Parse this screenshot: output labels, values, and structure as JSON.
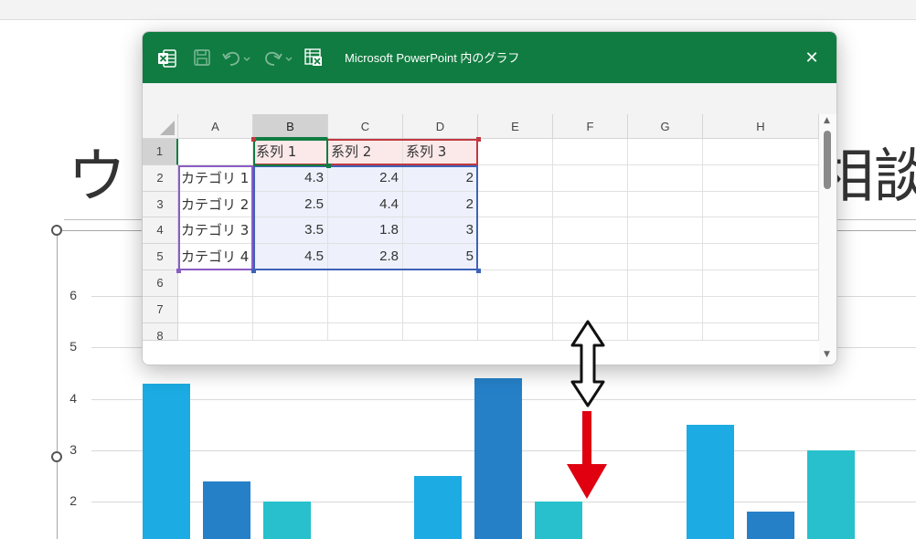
{
  "slide": {
    "title_left": "ウ",
    "title_right": "相談",
    "y_ticks": [
      "6",
      "5",
      "4",
      "3",
      "2"
    ]
  },
  "excel": {
    "window_title": "Microsoft PowerPoint 内のグラフ",
    "icons": [
      "excel-logo-icon",
      "save-icon",
      "undo-icon",
      "redo-icon",
      "edit-data-in-excel-icon",
      "close-icon"
    ],
    "close_glyph": "✕",
    "columns": [
      "A",
      "B",
      "C",
      "D",
      "E",
      "F",
      "G",
      "H"
    ],
    "rows": [
      "1",
      "2",
      "3",
      "4",
      "5",
      "6",
      "7",
      "8"
    ],
    "cells": {
      "B1": "系列 1",
      "C1": "系列 2",
      "D1": "系列 3",
      "A2": "カテゴリ 1",
      "B2": "4.3",
      "C2": "2.4",
      "D2": "2",
      "A3": "カテゴリ 2",
      "B3": "2.5",
      "C3": "4.4",
      "D3": "2",
      "A4": "カテゴリ 3",
      "B4": "3.5",
      "C4": "1.8",
      "D4": "3",
      "A5": "カテゴリ 4",
      "B5": "4.5",
      "C5": "2.8",
      "D5": "5"
    }
  },
  "colors": {
    "excel_green": "#107c41",
    "series1": "#1cabe2",
    "series2": "#2680c8",
    "series3": "#27c0cc",
    "series_range": "#c0393f",
    "value_range": "#3d62b8",
    "category_range": "#8b5cc4",
    "annotation_red": "#e00010"
  },
  "chart_data": {
    "type": "bar",
    "categories": [
      "カテゴリ 1",
      "カテゴリ 2",
      "カテゴリ 3",
      "カテゴリ 4"
    ],
    "series": [
      {
        "name": "系列 1",
        "values": [
          4.3,
          2.5,
          3.5,
          4.5
        ]
      },
      {
        "name": "系列 2",
        "values": [
          2.4,
          4.4,
          1.8,
          2.8
        ]
      },
      {
        "name": "系列 3",
        "values": [
          2,
          2,
          3,
          5
        ]
      }
    ],
    "visible_categories": 3,
    "ylim": [
      0,
      6
    ],
    "yticks": [
      2,
      3,
      4,
      5,
      6
    ],
    "grid": true
  }
}
